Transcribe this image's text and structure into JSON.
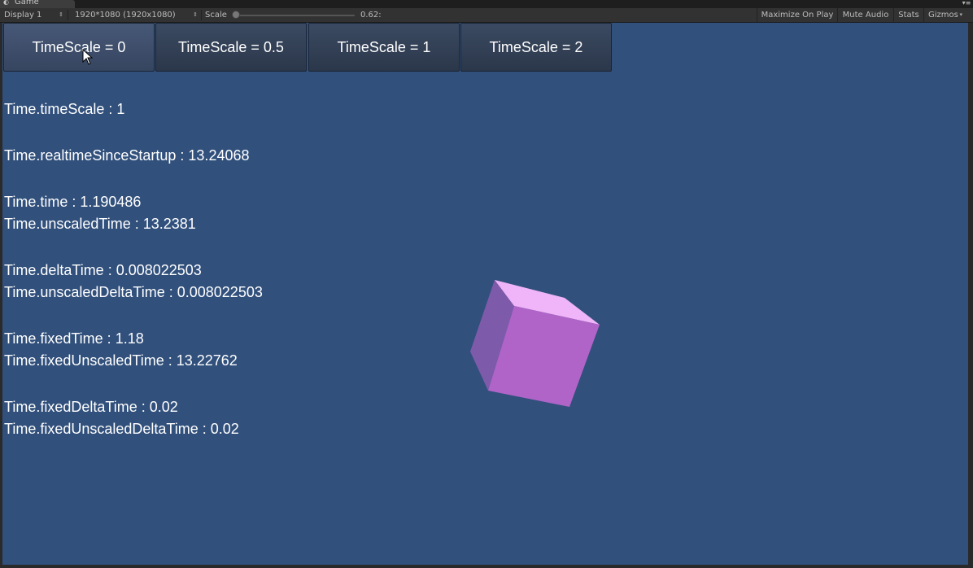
{
  "tab": {
    "title": "Game",
    "icon": "pacman-icon",
    "menu_icon": "tab-menu-icon"
  },
  "toolbar": {
    "display": "Display 1",
    "resolution": "1920*1080 (1920x1080)",
    "scale_label": "Scale",
    "scale_value": "0.62:",
    "maximize_on_play": "Maximize On Play",
    "mute_audio": "Mute Audio",
    "stats": "Stats",
    "gizmos": "Gizmos"
  },
  "buttons": [
    {
      "label": "TimeScale = 0"
    },
    {
      "label": "TimeScale = 0.5"
    },
    {
      "label": "TimeScale = 1"
    },
    {
      "label": "TimeScale = 2"
    }
  ],
  "stats": {
    "time_scale": "Time.timeScale : 1",
    "realtime_since_startup": "Time.realtimeSinceStartup : 13.24068",
    "time": "Time.time : 1.190486",
    "unscaled_time": "Time.unscaledTime : 13.2381",
    "delta_time": "Time.deltaTime : 0.008022503",
    "unscaled_delta_time": "Time.unscaledDeltaTime : 0.008022503",
    "fixed_time": "Time.fixedTime : 1.18",
    "fixed_unscaled_time": "Time.fixedUnscaledTime : 13.22762",
    "fixed_delta_time": "Time.fixedDeltaTime : 0.02",
    "fixed_unscaled_delta_time": "Time.fixedUnscaledDeltaTime : 0.02"
  },
  "colors": {
    "game_background": "#31507c",
    "cube_front": "#b064c8",
    "cube_top": "#f0b4f8",
    "cube_left": "#7e5aaa"
  }
}
